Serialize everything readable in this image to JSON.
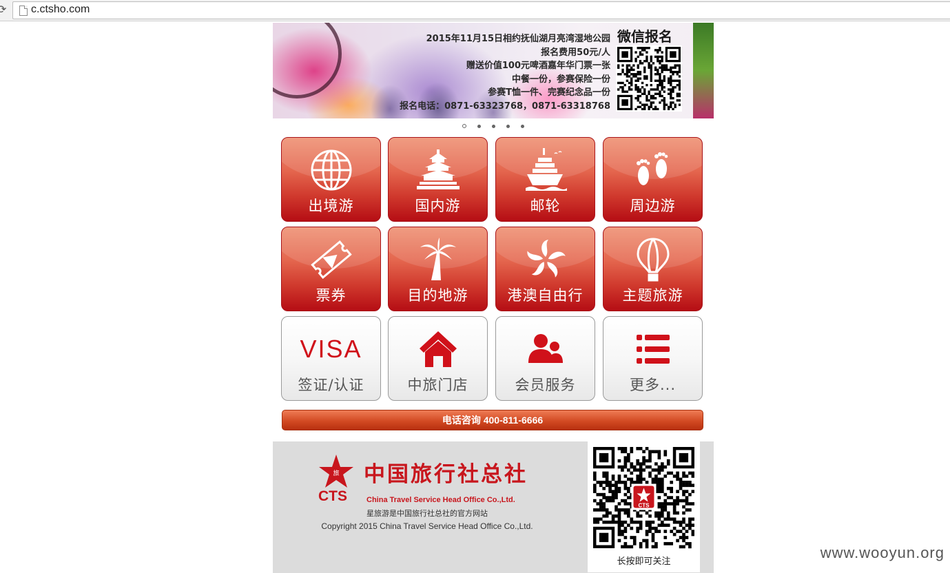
{
  "browser": {
    "url": "c.ctsho.com"
  },
  "banner": {
    "title": "微信报名",
    "lines": [
      "2015年11月15日相约抚仙湖月亮湾湿地公园",
      "报名费用50元/人",
      "赠送价值100元啤酒嘉年华门票一张",
      "中餐一份，参赛保险一份",
      "参赛T恤一件、完赛纪念品一份",
      "报名电话：0871-63323768，0871-63318768"
    ],
    "slide_count": 5,
    "active_slide": 1
  },
  "tiles": [
    {
      "label": "出境游",
      "icon": "globe-icon",
      "style": "red"
    },
    {
      "label": "国内游",
      "icon": "temple-of-heaven-icon",
      "style": "red"
    },
    {
      "label": "邮轮",
      "icon": "cruise-ship-icon",
      "style": "red"
    },
    {
      "label": "周边游",
      "icon": "footprints-icon",
      "style": "red"
    },
    {
      "label": "票券",
      "icon": "ticket-icon",
      "style": "red"
    },
    {
      "label": "目的地游",
      "icon": "palm-tree-icon",
      "style": "red"
    },
    {
      "label": "港澳自由行",
      "icon": "bauhinia-flower-icon",
      "style": "red"
    },
    {
      "label": "主题旅游",
      "icon": "hot-air-balloon-icon",
      "style": "red"
    },
    {
      "label": "签证/认证",
      "icon": "visa-icon",
      "icon_text": "VISA",
      "style": "grey"
    },
    {
      "label": "中旅门店",
      "icon": "house-icon",
      "style": "grey"
    },
    {
      "label": "会员服务",
      "icon": "members-icon",
      "style": "grey"
    },
    {
      "label": "更多...",
      "icon": "list-icon",
      "style": "grey"
    }
  ],
  "call_bar": {
    "label": "电话咨询 400-811-6666"
  },
  "footer": {
    "logo_cn": "中国旅行社总社",
    "logo_abbr": "CTS",
    "logo_en": "China Travel Service Head Office Co.,Ltd.",
    "line1": "星旅游是中国旅行社总社的官方网站",
    "line2": "Copyright 2015 China Travel Service Head Office Co.,Ltd.",
    "qr_caption": "长按即可关注",
    "qr_badge": "CTS"
  },
  "watermark": "www.wooyun.org",
  "colors": {
    "brand_red": "#c8161d",
    "tile_red": "#d0392d",
    "call_orange": "#d24a23",
    "footer_bg": "#dcdcdc"
  }
}
